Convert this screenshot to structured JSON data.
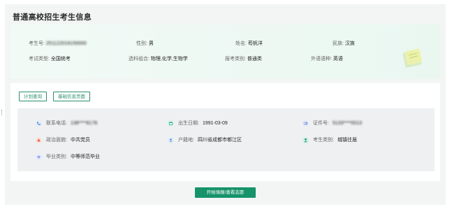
{
  "page_title": "普通高校招生考生信息",
  "info": {
    "row1": [
      {
        "label": "考生号:",
        "value": "251122019150000"
      },
      {
        "label": "性别:",
        "value": "男"
      },
      {
        "label": "姓名:",
        "value": "苟帆洋"
      },
      {
        "label": "民族:",
        "value": "汉族"
      }
    ],
    "row2": [
      {
        "label": "考试类型:",
        "value": "全国统考"
      },
      {
        "label": "选科组合:",
        "value": "物理,化学,生物学"
      },
      {
        "label": "报考类别:",
        "value": "普通类"
      },
      {
        "label": "外语语种:",
        "value": "英语"
      }
    ]
  },
  "buttons": {
    "plan_query": "计划查询",
    "basic_info_page": "基础信息页面",
    "start_fill": "开始填报/查看志愿"
  },
  "details": [
    {
      "label": "联系电话:",
      "value": "138****8178",
      "icon": "phone-icon",
      "color": "#5b8fd6"
    },
    {
      "label": "出生日期:",
      "value": "1991-03-09",
      "icon": "calendar-icon",
      "color": "#2bb389"
    },
    {
      "label": "证件号:",
      "value": "5133****0013",
      "icon": "id-card-icon",
      "color": "#8fa6e0"
    },
    {
      "label": "政治面貌:",
      "value": "中共党员",
      "icon": "party-icon",
      "color": "#e46d4a"
    },
    {
      "label": "户籍地:",
      "value": "四川省成都市郫江区",
      "icon": "location-icon",
      "color": "#6a9be0"
    },
    {
      "label": "考生类别:",
      "value": "城镇往届",
      "icon": "user-icon",
      "color": "#1c9c74"
    },
    {
      "label": "毕业类别:",
      "value": "中等师范毕业",
      "icon": "graduation-icon",
      "color": "#8fa3e8"
    }
  ],
  "colors": {
    "accent": "#16936a",
    "panel": "#f3f5f4",
    "info_bg": "#eaf7f1"
  }
}
